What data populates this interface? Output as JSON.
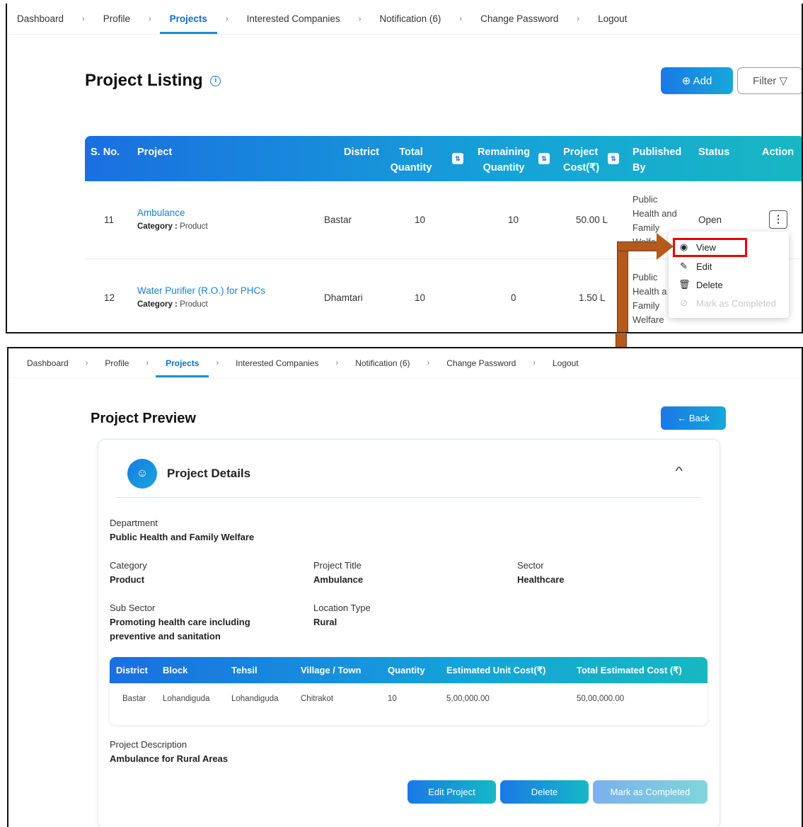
{
  "nav": {
    "dashboard": "Dashboard",
    "profile": "Profile",
    "projects": "Projects",
    "interested": "Interested Companies",
    "notification": "Notification (6)",
    "change_password": "Change Password",
    "logout": "Logout",
    "sep": "›"
  },
  "listing": {
    "title": "Project Listing",
    "info": "i",
    "add_label": "⊕ Add",
    "filter_label": "Filter ▽",
    "headers": {
      "sno": "S. No.",
      "project": "Project",
      "district": "District",
      "total_qty_1": "Total",
      "total_qty_2": "Quantity",
      "remaining_1": "Remaining",
      "remaining_2": "Quantity",
      "cost_1": "Project",
      "cost_2": "Cost(₹)",
      "published_1": "Published",
      "published_2": "By",
      "status": "Status",
      "action": "Action",
      "sort_glyph": "⇅"
    },
    "rows": [
      {
        "sno": "11",
        "project": "Ambulance",
        "category_label": "Category :",
        "category": "Product",
        "district": "Bastar",
        "total": "10",
        "remaining": "10",
        "cost": "50.00 L",
        "published_1": "Public",
        "published_2": "Health and",
        "published_3": "Family",
        "published_4": "Welfare",
        "status": "Open",
        "action": "⋮"
      },
      {
        "sno": "12",
        "project": "Water Purifier (R.O.) for PHCs",
        "category_label": "Category :",
        "category": "Product",
        "district": "Dhamtari",
        "total": "10",
        "remaining": "0",
        "cost": "1.50 L",
        "published_1": "Public",
        "published_2": "Health a",
        "published_3": "Family",
        "published_4": "Welfare"
      }
    ],
    "menu": {
      "view": "View",
      "edit": "Edit",
      "delete": "Delete",
      "mark": "Mark as Completed"
    }
  },
  "preview": {
    "title": "Project Preview",
    "back_label": "← Back",
    "section_title": "Project Details",
    "chevron": "^",
    "department_label": "Department",
    "department": "Public Health and Family Welfare",
    "category_label": "Category",
    "category": "Product",
    "project_title_label": "Project Title",
    "project_title": "Ambulance",
    "sector_label": "Sector",
    "sector": "Healthcare",
    "subsector_label": "Sub Sector",
    "subsector_1": "Promoting health care including",
    "subsector_2": "preventive and sanitation",
    "location_type_label": "Location Type",
    "location_type": "Rural",
    "table": {
      "headers": [
        "District",
        "Block",
        "Tehsil",
        "Village / Town",
        "Quantity",
        "Estimated Unit Cost(₹)",
        "Total Estimated Cost (₹)"
      ],
      "row": [
        "Bastar",
        "Lohandiguda",
        "Lohandiguda",
        "Chitrakot",
        "10",
        "5,00,000.00",
        "50,00,000.00"
      ]
    },
    "description_label": "Project Description",
    "description": "Ambulance for Rural Areas",
    "edit_label": "Edit Project",
    "delete_label": "Delete",
    "mark_label": "Mark as Completed"
  },
  "colors": {
    "accent": "#1a78e6",
    "teal": "#18b7c2",
    "highlight": "#e00000",
    "arrow": "#b35a1c"
  }
}
